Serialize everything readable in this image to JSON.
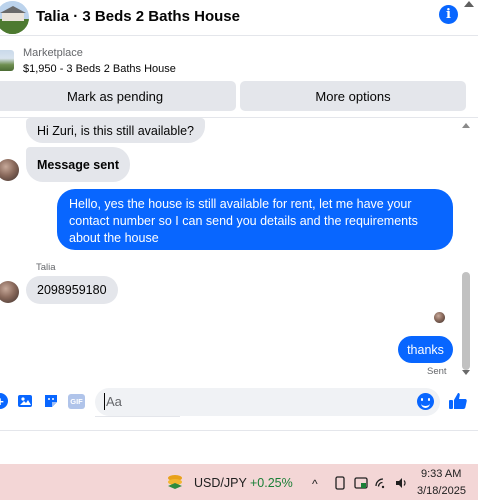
{
  "header": {
    "title": "Talia · 3 Beds 2 Baths House",
    "info_icon": "info-icon"
  },
  "marketplace": {
    "label": "Marketplace",
    "listing": "$1,950 - 3 Beds 2 Baths House"
  },
  "actions": {
    "pending_label": "Mark as pending",
    "more_label": "More options"
  },
  "messages": {
    "incoming_1": "Hi Zuri, is this still available?",
    "incoming_2": "Message sent",
    "outgoing_1": "Hello, yes the house is still available for rent, let me have your contact number so I can send you details and the requirements about the house",
    "sender_name": "Talia",
    "incoming_3": "2098959180",
    "outgoing_2": "thanks",
    "status": "Sent"
  },
  "composer": {
    "placeholder": "Aa",
    "gif_label": "GIF",
    "plus_symbol": "+"
  },
  "taskbar": {
    "ticker_name": "USD/JPY",
    "ticker_change": "+0.25%",
    "chevron": "^",
    "time": "9:33 AM",
    "date": "3/18/2025"
  },
  "colors": {
    "accent": "#0866ff",
    "bubble_incoming": "#e4e6eb",
    "taskbar_bg": "#f3d6d6",
    "ticker_positive": "#1a7f37"
  }
}
